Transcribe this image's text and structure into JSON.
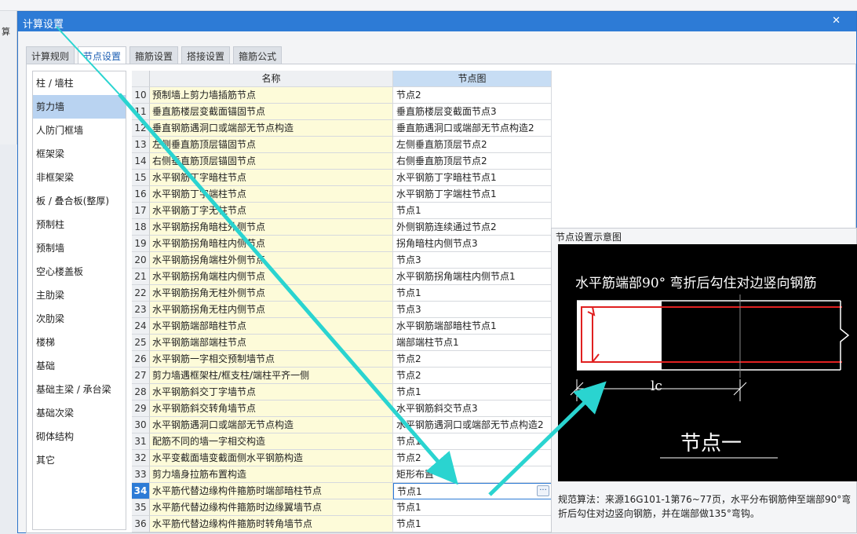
{
  "background": {
    "left_label": "算"
  },
  "dialog": {
    "title": "计算设置",
    "close_glyph": "✕",
    "tabs": [
      {
        "label": "计算规则",
        "active": false
      },
      {
        "label": "节点设置",
        "active": true
      },
      {
        "label": "箍筋设置",
        "active": false
      },
      {
        "label": "搭接设置",
        "active": false
      },
      {
        "label": "箍筋公式",
        "active": false
      }
    ]
  },
  "categories": [
    {
      "label": "柱 / 墙柱",
      "selected": false
    },
    {
      "label": "剪力墙",
      "selected": true
    },
    {
      "label": "人防门框墙",
      "selected": false
    },
    {
      "label": "框架梁",
      "selected": false
    },
    {
      "label": "非框架梁",
      "selected": false
    },
    {
      "label": "板 / 叠合板(整厚)",
      "selected": false
    },
    {
      "label": "预制柱",
      "selected": false
    },
    {
      "label": "预制墙",
      "selected": false
    },
    {
      "label": "空心楼盖板",
      "selected": false
    },
    {
      "label": "主肋梁",
      "selected": false
    },
    {
      "label": "次肋梁",
      "selected": false
    },
    {
      "label": "楼梯",
      "selected": false
    },
    {
      "label": "基础",
      "selected": false
    },
    {
      "label": "基础主梁 / 承台梁",
      "selected": false
    },
    {
      "label": "基础次梁",
      "selected": false
    },
    {
      "label": "砌体结构",
      "selected": false
    },
    {
      "label": "其它",
      "selected": false
    }
  ],
  "grid": {
    "headers": {
      "name": "名称",
      "node": "节点图"
    },
    "rows": [
      {
        "num": "10",
        "name": "预制墙上剪力墙插筋节点",
        "node": "节点2"
      },
      {
        "num": "11",
        "name": "垂直筋楼层变截面锚固节点",
        "node": "垂直筋楼层变截面节点3"
      },
      {
        "num": "12",
        "name": "垂直钢筋遇洞口或端部无节点构造",
        "node": "垂直筋遇洞口或端部无节点构造2"
      },
      {
        "num": "13",
        "name": "左侧垂直筋顶层锚固节点",
        "node": "左侧垂直筋顶层节点2"
      },
      {
        "num": "14",
        "name": "右侧垂直筋顶层锚固节点",
        "node": "右侧垂直筋顶层节点2"
      },
      {
        "num": "15",
        "name": "水平钢筋丁字暗柱节点",
        "node": "水平钢筋丁字暗柱节点1"
      },
      {
        "num": "16",
        "name": "水平钢筋丁字端柱节点",
        "node": "水平钢筋丁字端柱节点1"
      },
      {
        "num": "17",
        "name": "水平钢筋丁字无柱节点",
        "node": "节点1"
      },
      {
        "num": "18",
        "name": "水平钢筋拐角暗柱外侧节点",
        "node": "外侧钢筋连续通过节点2"
      },
      {
        "num": "19",
        "name": "水平钢筋拐角暗柱内侧节点",
        "node": "拐角暗柱内侧节点3"
      },
      {
        "num": "20",
        "name": "水平钢筋拐角端柱外侧节点",
        "node": "节点3"
      },
      {
        "num": "21",
        "name": "水平钢筋拐角端柱内侧节点",
        "node": "水平钢筋拐角端柱内侧节点1"
      },
      {
        "num": "22",
        "name": "水平钢筋拐角无柱外侧节点",
        "node": "节点1"
      },
      {
        "num": "23",
        "name": "水平钢筋拐角无柱内侧节点",
        "node": "节点3"
      },
      {
        "num": "24",
        "name": "水平钢筋端部暗柱节点",
        "node": "水平钢筋端部暗柱节点1"
      },
      {
        "num": "25",
        "name": "水平钢筋端部端柱节点",
        "node": "端部端柱节点1"
      },
      {
        "num": "26",
        "name": "水平钢筋一字相交预制墙节点",
        "node": "节点2"
      },
      {
        "num": "27",
        "name": "剪力墙遇框架柱/框支柱/端柱平齐一侧",
        "node": "节点2"
      },
      {
        "num": "28",
        "name": "水平钢筋斜交丁字墙节点",
        "node": "节点1"
      },
      {
        "num": "29",
        "name": "水平钢筋斜交转角墙节点",
        "node": "水平钢筋斜交节点3"
      },
      {
        "num": "30",
        "name": "水平钢筋遇洞口或端部无节点构造",
        "node": "水平钢筋遇洞口或端部无节点构造2"
      },
      {
        "num": "31",
        "name": "配筋不同的墙一字相交构造",
        "node": "节点1"
      },
      {
        "num": "32",
        "name": "水平变截面墙变截面侧水平钢筋构造",
        "node": "节点2"
      },
      {
        "num": "33",
        "name": "剪力墙身拉筋布置构造",
        "node": "矩形布置"
      },
      {
        "num": "34",
        "name": "水平筋代替边缘构件箍筋时端部暗柱节点",
        "node": "节点1",
        "selected": true
      },
      {
        "num": "35",
        "name": "水平筋代替边缘构件箍筋时边缘翼墙节点",
        "node": "节点1"
      },
      {
        "num": "36",
        "name": "水平筋代替边缘构件箍筋时转角墙节点",
        "node": "节点1"
      }
    ],
    "ellipsis": "···"
  },
  "preview": {
    "title": "节点设置示意图",
    "diagram_caption": "水平筋端部90° 弯折后勾住对边竖向钢筋",
    "dimension_label": "lc",
    "node_label": "节点一",
    "description": "规范算法：来源16G101-1第76~77页，水平分布钢筋伸至端部90°弯折后勾住对边竖向钢筋，并在端部做135°弯钩。"
  },
  "colors": {
    "titlebar": "#2d7bd6",
    "name_cell_bg": "#fdfbd9",
    "selected_category": "#b9d3f1",
    "rebar_red": "#e02020",
    "annotation_arrow": "#2ad4d0"
  }
}
